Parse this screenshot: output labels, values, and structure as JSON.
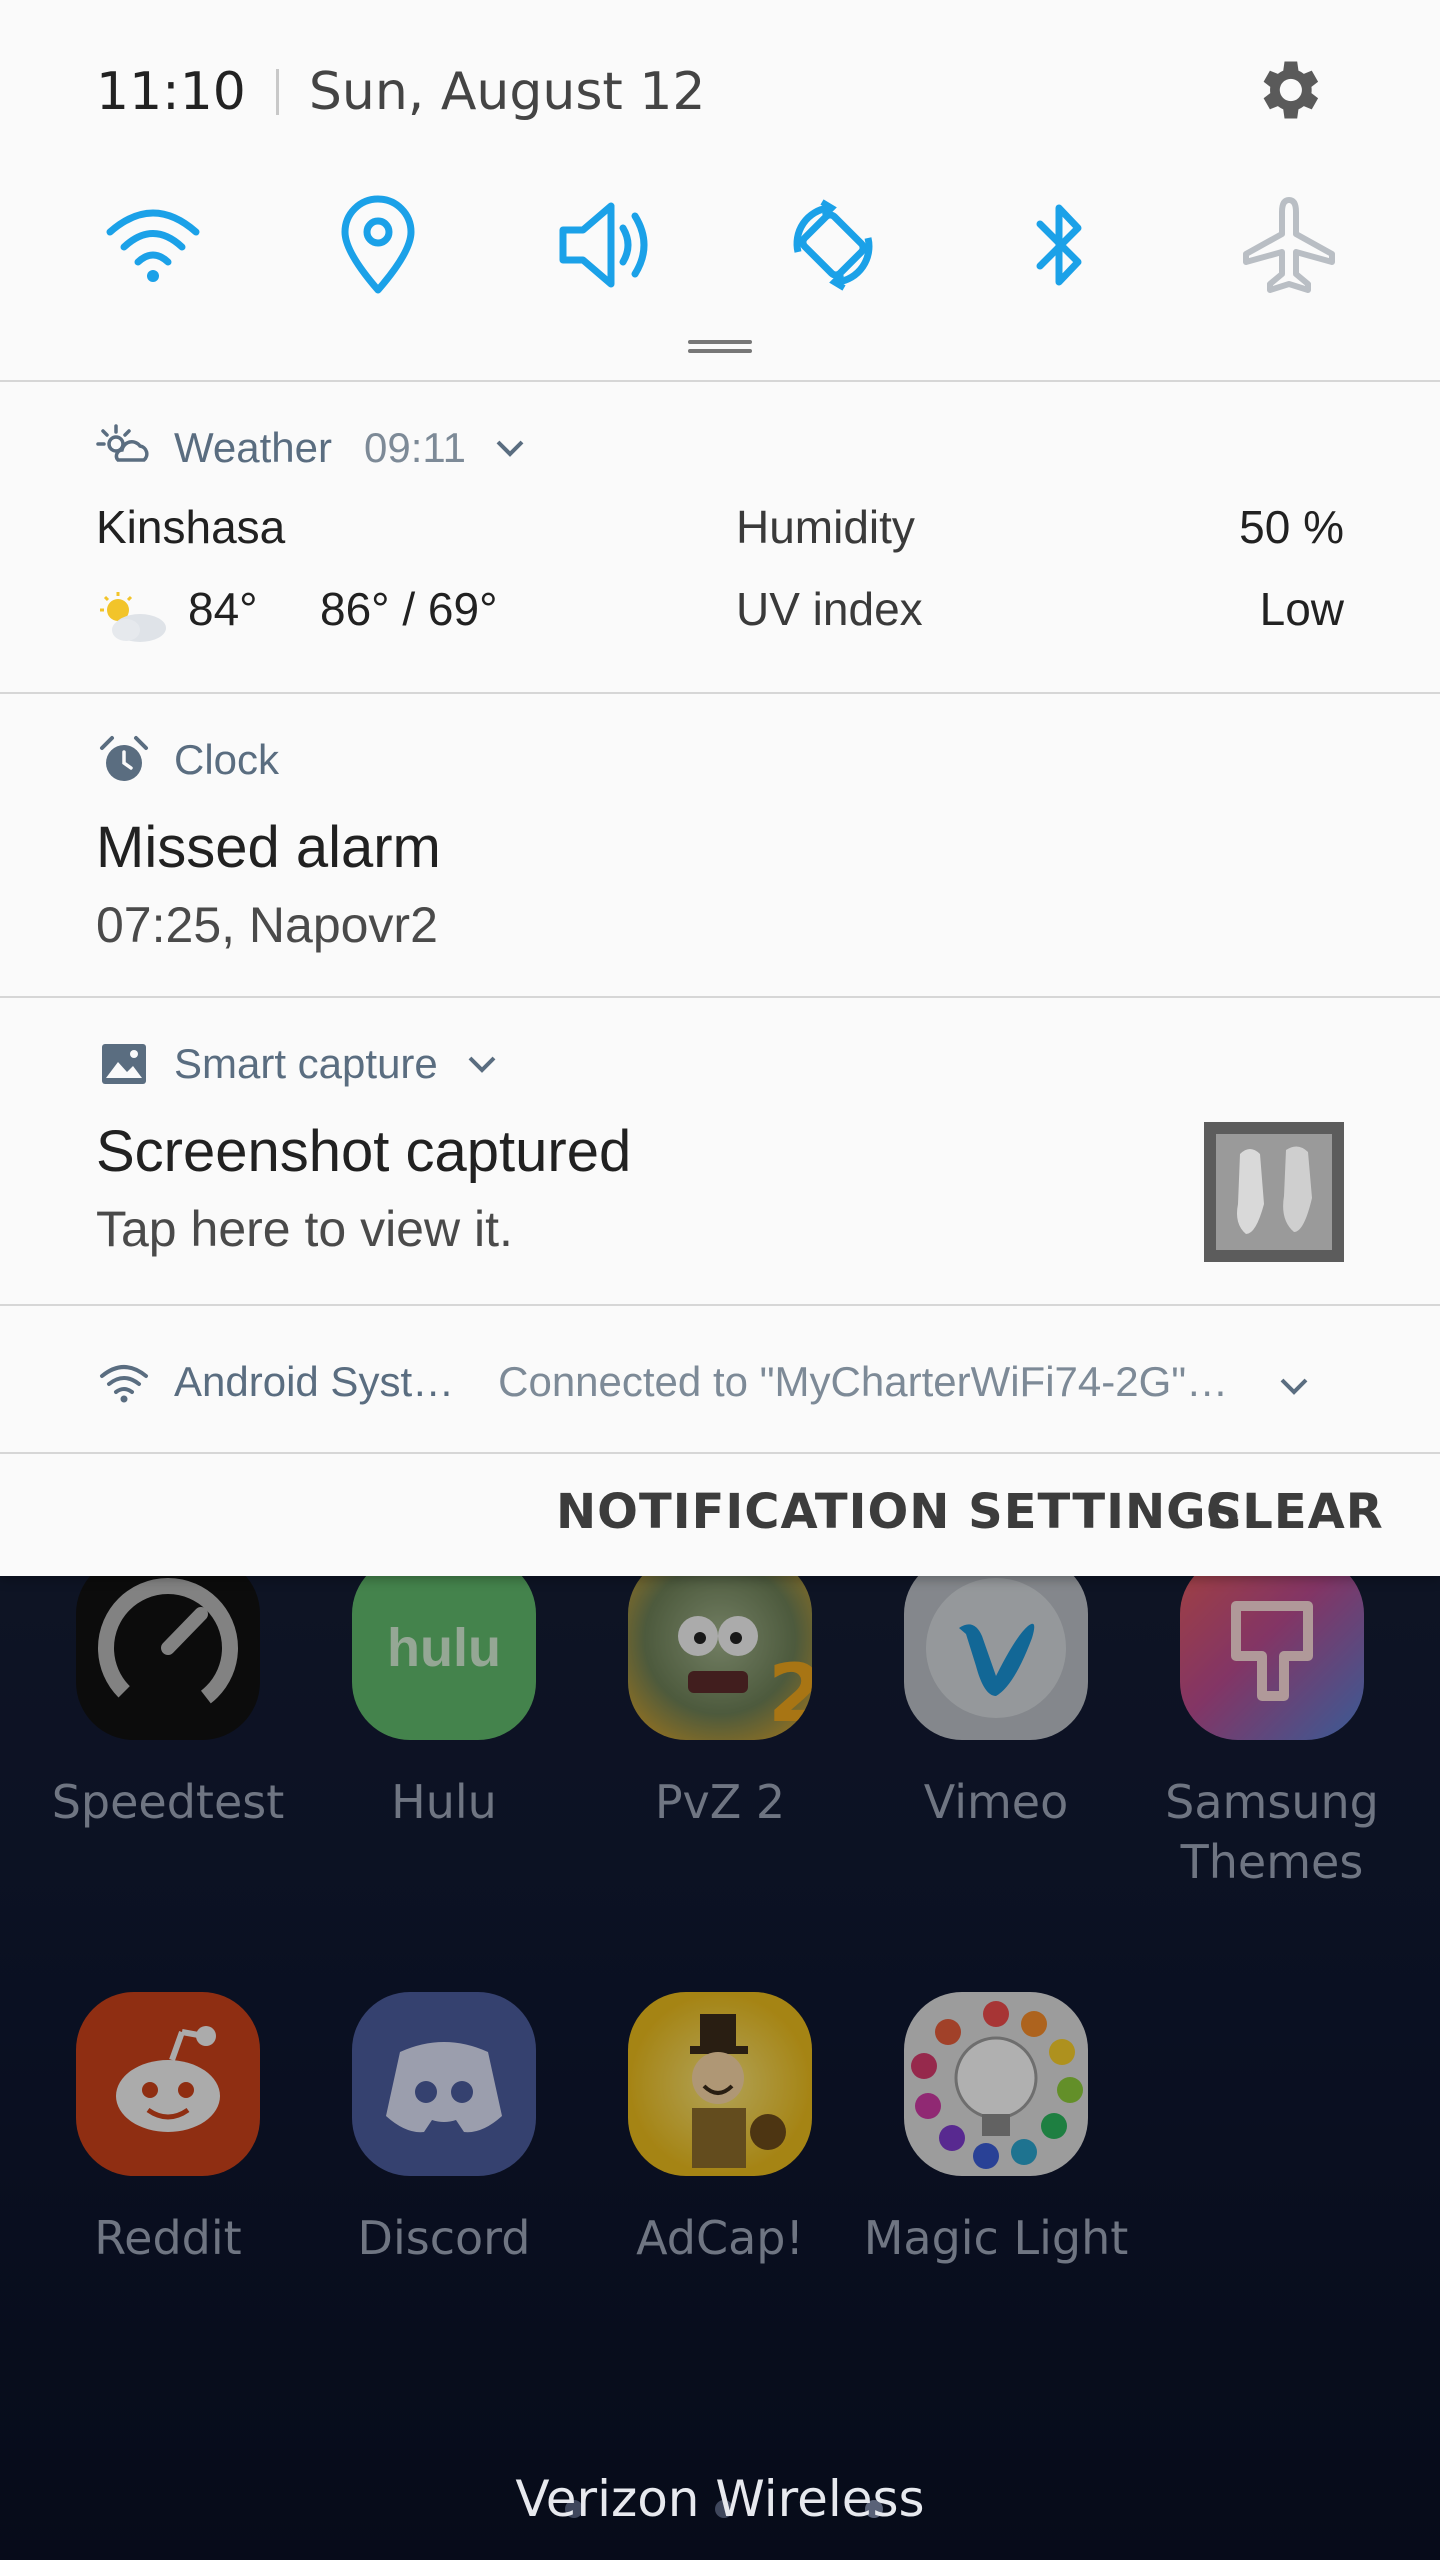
{
  "status_bar": {
    "time": "11:10",
    "date": "Sun, August 12"
  },
  "quick_settings": {
    "accent_color": "#1ba1e8",
    "inactive_color": "#b9bec4",
    "tiles": [
      "wifi-icon",
      "location-icon",
      "sound-icon",
      "auto-rotate-icon",
      "bluetooth-icon",
      "airplane-mode-icon"
    ]
  },
  "weather": {
    "app": "Weather",
    "time": "09:11",
    "city": "Kinshasa",
    "current": "84°",
    "high_low": "86° /  69°",
    "humidity_label": "Humidity",
    "humidity_value": "50 %",
    "uv_label": "UV index",
    "uv_value": "Low"
  },
  "clock": {
    "app": "Clock",
    "title": "Missed alarm",
    "detail": "07:25, Napovr2"
  },
  "capture": {
    "app": "Smart capture",
    "title": "Screenshot captured",
    "detail": "Tap here to view it."
  },
  "android": {
    "app": "Android Syst…",
    "detail": "Connected to \"MyCharterWiFi74-2G\"…"
  },
  "footer": {
    "settings_label": "NOTIFICATION SETTINGS",
    "clear_label": "CLEAR"
  },
  "home_apps": [
    {
      "label": "Speedtest"
    },
    {
      "label": "Hulu"
    },
    {
      "label": "PvZ 2"
    },
    {
      "label": "Vimeo"
    },
    {
      "label": "Samsung Themes"
    },
    {
      "label": "Reddit"
    },
    {
      "label": "Discord"
    },
    {
      "label": "AdCap!"
    },
    {
      "label": "Magic Light"
    }
  ],
  "hulu_logo": "hulu",
  "carrier": "Verizon Wireless"
}
